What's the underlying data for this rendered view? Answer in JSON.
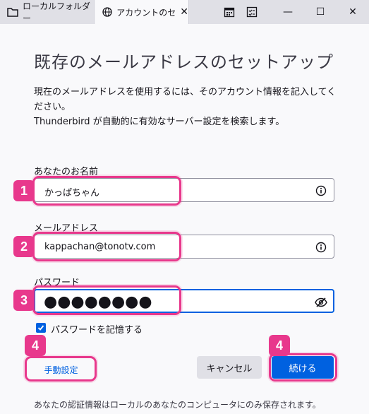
{
  "tabs": [
    {
      "label": "ローカルフォルダー",
      "icon": "folder-icon"
    },
    {
      "label": "アカウントのセットアップ",
      "icon": "globe-icon"
    }
  ],
  "toolbar_icons": [
    "calendar-icon",
    "tasks-icon"
  ],
  "window_controls": {
    "minimize": "—",
    "maximize": "☐",
    "close": "✕"
  },
  "heading": "既存のメールアドレスのセットアップ",
  "description": {
    "line1": "現在のメールアドレスを使用するには、そのアカウント情報を記入してください。",
    "line2": "Thunderbird が自動的に有効なサーバー設定を検索します。"
  },
  "form": {
    "name_label": "あなたのお名前",
    "name_value": "かっぱちゃん",
    "email_label": "メールアドレス",
    "email_value": "kappachan@tonotv.com",
    "password_label": "パスワード",
    "password_value": "●●●●●●●●",
    "remember_label": "パスワードを記憶する",
    "remember_checked": true
  },
  "badges": [
    "1",
    "2",
    "3",
    "4",
    "4"
  ],
  "buttons": {
    "manual": "手動設定",
    "cancel": "キャンセル",
    "continue": "続ける"
  },
  "footer": "あなたの認証情報はローカルのあなたのコンピュータにのみ保存されます。",
  "colors": {
    "accent": "#0061e0",
    "highlight": "#e8388c"
  }
}
